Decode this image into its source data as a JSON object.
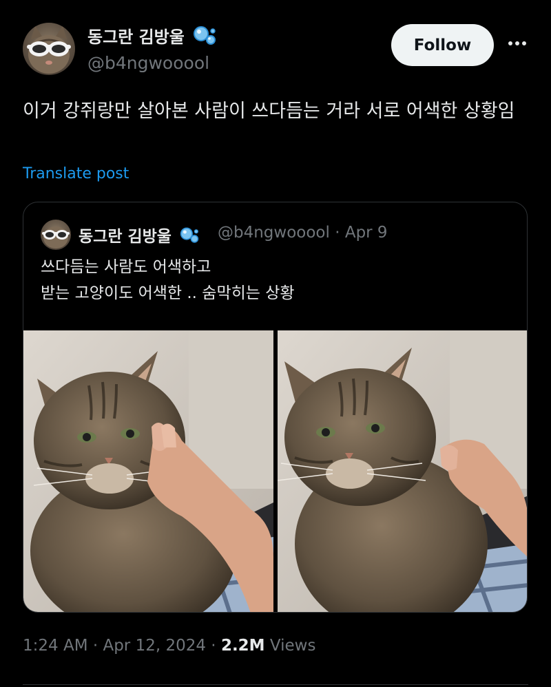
{
  "author": {
    "display_name": "동그란 김방울",
    "handle": "@b4ngwooool",
    "avatar_icon": "cat-with-sunglasses-avatar",
    "badge_icon": "bubbles-emoji"
  },
  "actions": {
    "follow_label": "Follow",
    "more_icon": "more-horizontal-icon"
  },
  "post": {
    "text": "이거 강쥐랑만 살아본 사람이 쓰다듬는 거라 서로 어색한 상황임",
    "translate_label": "Translate post"
  },
  "quote": {
    "display_name": "동그란 김방울",
    "meta": "@b4ngwooool · Apr 9",
    "text_line1": "쓰다듬는 사람도 어색하고",
    "text_line2": "받는 고양이도 어색한 .. 숨막히는 상황",
    "images": [
      "tabby-cat-being-petted-photo-1",
      "tabby-cat-being-petted-photo-2"
    ]
  },
  "footer": {
    "time": "1:24 AM · Apr 12, 2024 · ",
    "views_count": "2.2M",
    "views_label": " Views"
  },
  "colors": {
    "background": "#000000",
    "text": "#e7e9ea",
    "muted": "#71767b",
    "link": "#1d9bf0",
    "border": "#2f3336"
  }
}
